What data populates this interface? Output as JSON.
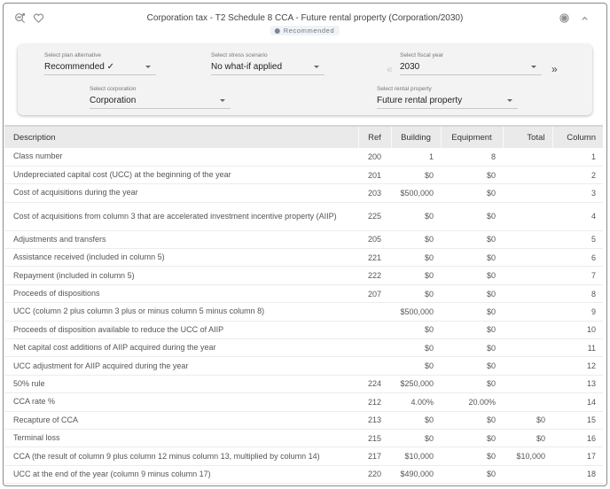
{
  "header": {
    "title": "Corporation tax - T2 Schedule 8 CCA - Future rental property (Corporation/2030)",
    "badge": "Recommended",
    "left_icons": [
      "insights-search-icon",
      "heart-icon"
    ],
    "right_icons": [
      "settings-badge-icon",
      "chevron-up-icon"
    ]
  },
  "filters": {
    "plan_alternative": {
      "label": "Select plan alternative",
      "value": "Recommended ✓"
    },
    "stress_scenario": {
      "label": "Select stress scenario",
      "value": "No what-if applied"
    },
    "fiscal_year": {
      "label": "Select fiscal year",
      "value": "2030",
      "prev": "«",
      "next": "»"
    },
    "corporation": {
      "label": "Select corporation",
      "value": "Corporation"
    },
    "rental_property": {
      "label": "Select rental property",
      "value": "Future rental property"
    }
  },
  "table": {
    "columns": [
      "Description",
      "Ref",
      "Building",
      "Equipment",
      "Total",
      "Column"
    ],
    "rows": [
      {
        "desc": "Class number",
        "ref": "200",
        "building": "1",
        "equipment": "8",
        "total": "",
        "column": "1"
      },
      {
        "desc": "Undepreciated capital cost (UCC) at the beginning of the year",
        "ref": "201",
        "building": "$0",
        "equipment": "$0",
        "total": "",
        "column": "2"
      },
      {
        "desc": "Cost of acquisitions during the year",
        "ref": "203",
        "building": "$500,000",
        "equipment": "$0",
        "total": "",
        "column": "3"
      },
      {
        "desc": "Cost of acquisitions from column 3 that are accelerated investment incentive property (AIIP)",
        "ref": "225",
        "building": "$0",
        "equipment": "$0",
        "total": "",
        "column": "4"
      },
      {
        "desc": "Adjustments and transfers",
        "ref": "205",
        "building": "$0",
        "equipment": "$0",
        "total": "",
        "column": "5"
      },
      {
        "desc": "Assistance received (included in column 5)",
        "ref": "221",
        "building": "$0",
        "equipment": "$0",
        "total": "",
        "column": "6"
      },
      {
        "desc": "Repayment (included in column 5)",
        "ref": "222",
        "building": "$0",
        "equipment": "$0",
        "total": "",
        "column": "7"
      },
      {
        "desc": "Proceeds of dispositions",
        "ref": "207",
        "building": "$0",
        "equipment": "$0",
        "total": "",
        "column": "8"
      },
      {
        "desc": "UCC (column 2 plus column 3 plus or minus column 5 minus column 8)",
        "ref": "",
        "building": "$500,000",
        "equipment": "$0",
        "total": "",
        "column": "9"
      },
      {
        "desc": "Proceeds of disposition available to reduce the UCC of AIIP",
        "ref": "",
        "building": "$0",
        "equipment": "$0",
        "total": "",
        "column": "10"
      },
      {
        "desc": "Net capital cost additions of AIIP acquired during the year",
        "ref": "",
        "building": "$0",
        "equipment": "$0",
        "total": "",
        "column": "11"
      },
      {
        "desc": "UCC adjustment for AIIP acquired during the year",
        "ref": "",
        "building": "$0",
        "equipment": "$0",
        "total": "",
        "column": "12"
      },
      {
        "desc": "50% rule",
        "ref": "224",
        "building": "$250,000",
        "equipment": "$0",
        "total": "",
        "column": "13"
      },
      {
        "desc": "CCA rate %",
        "ref": "212",
        "building": "4.00%",
        "equipment": "20.00%",
        "total": "",
        "column": "14"
      },
      {
        "desc": "Recapture of CCA",
        "ref": "213",
        "building": "$0",
        "equipment": "$0",
        "total": "$0",
        "column": "15"
      },
      {
        "desc": "Terminal loss",
        "ref": "215",
        "building": "$0",
        "equipment": "$0",
        "total": "$0",
        "column": "16"
      },
      {
        "desc": "CCA (the result of column 9 plus column 12 minus column 13, multiplied by column 14)",
        "ref": "217",
        "building": "$10,000",
        "equipment": "$0",
        "total": "$10,000",
        "column": "17"
      },
      {
        "desc": "UCC at the end of the year (column 9 minus column 17)",
        "ref": "220",
        "building": "$490,000",
        "equipment": "$0",
        "total": "",
        "column": "18"
      }
    ]
  }
}
